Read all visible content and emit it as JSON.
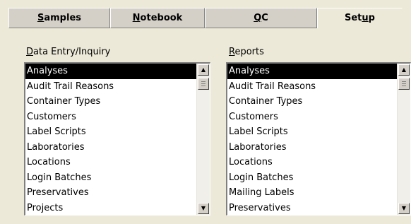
{
  "tabs": [
    {
      "accel": "S",
      "rest": "amples"
    },
    {
      "accel": "N",
      "rest": "otebook"
    },
    {
      "accel": "Q",
      "rest": "C"
    },
    {
      "pre": "Set",
      "accel": "u",
      "rest": "p"
    }
  ],
  "data_entry": {
    "label_accel": "D",
    "label_rest": "ata Entry/Inquiry",
    "items": [
      "Analyses",
      "Audit Trail Reasons",
      "Container Types",
      "Customers",
      "Label Scripts",
      "Laboratories",
      "Locations",
      "Login Batches",
      "Preservatives",
      "Projects"
    ],
    "selected": "Analyses"
  },
  "reports": {
    "label_accel": "R",
    "label_rest": "eports",
    "items": [
      "Analyses",
      "Audit Trail Reasons",
      "Container Types",
      "Customers",
      "Label Scripts",
      "Laboratories",
      "Locations",
      "Login Batches",
      "Mailing Labels",
      "Preservatives"
    ],
    "selected": "Analyses"
  },
  "icons": {
    "scroll_up": "▲",
    "scroll_down": "▼"
  }
}
